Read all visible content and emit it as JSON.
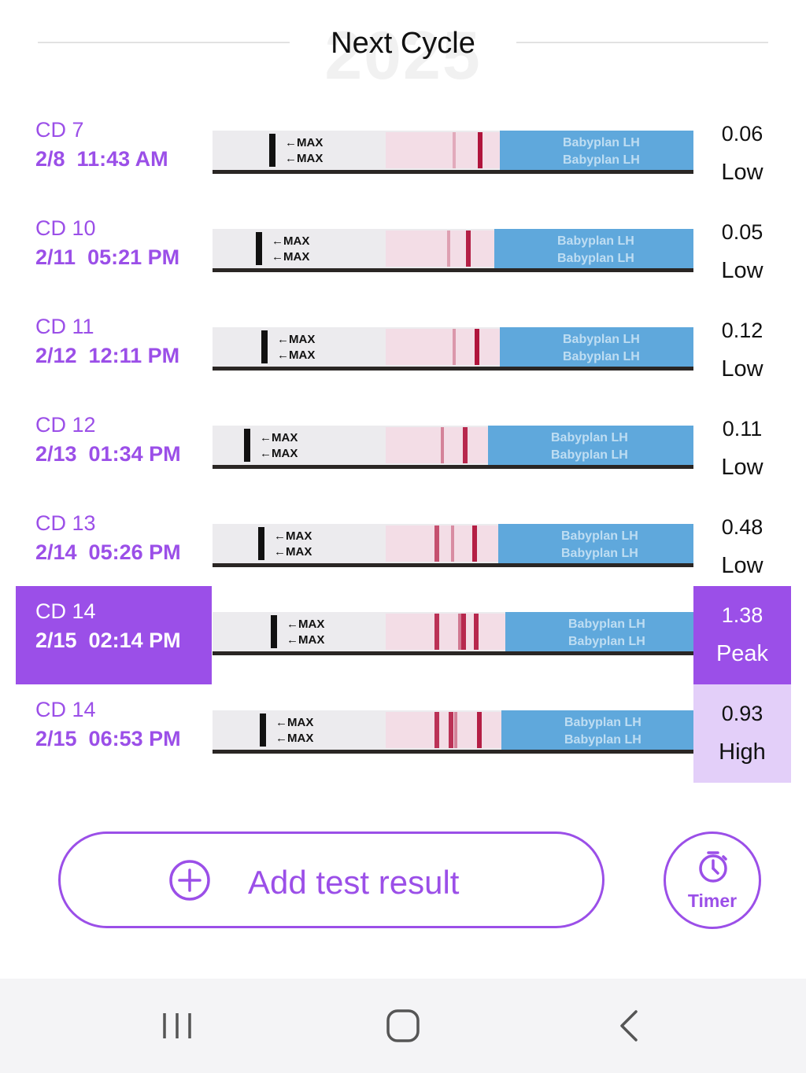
{
  "header": {
    "title": "Next Cycle",
    "year_watermark": "2025"
  },
  "strip_text": {
    "max": "←MAX",
    "brand": "Babyplan",
    "lh": "LH"
  },
  "entries": [
    {
      "cd": "CD 7",
      "datetime": "2/8  11:43 AM",
      "value": "0.06",
      "level": "Low",
      "state": "normal"
    },
    {
      "cd": "CD 10",
      "datetime": "2/11  05:21 PM",
      "value": "0.05",
      "level": "Low",
      "state": "normal"
    },
    {
      "cd": "CD 11",
      "datetime": "2/12  12:11 PM",
      "value": "0.12",
      "level": "Low",
      "state": "normal"
    },
    {
      "cd": "CD 12",
      "datetime": "2/13  01:34 PM",
      "value": "0.11",
      "level": "Low",
      "state": "normal"
    },
    {
      "cd": "CD 13",
      "datetime": "2/14  05:26 PM",
      "value": "0.48",
      "level": "Low",
      "state": "normal"
    },
    {
      "cd": "CD 14",
      "datetime": "2/15  02:14 PM",
      "value": "1.38",
      "level": "Peak",
      "state": "selected"
    },
    {
      "cd": "CD 14",
      "datetime": "2/15  06:53 PM",
      "value": "0.93",
      "level": "High",
      "state": "high"
    }
  ],
  "actions": {
    "add_label": "Add test result",
    "timer_label": "Timer"
  },
  "icons": {
    "add": "plus-circle-icon",
    "timer": "stopwatch-icon",
    "nav_recent": "recent-apps-icon",
    "nav_home": "home-icon",
    "nav_back": "back-icon"
  },
  "colors": {
    "accent": "#9b4fe8",
    "high_bg": "#e3cff9",
    "strip_blue": "#5fa8dc",
    "test_line": "#b0143c"
  }
}
